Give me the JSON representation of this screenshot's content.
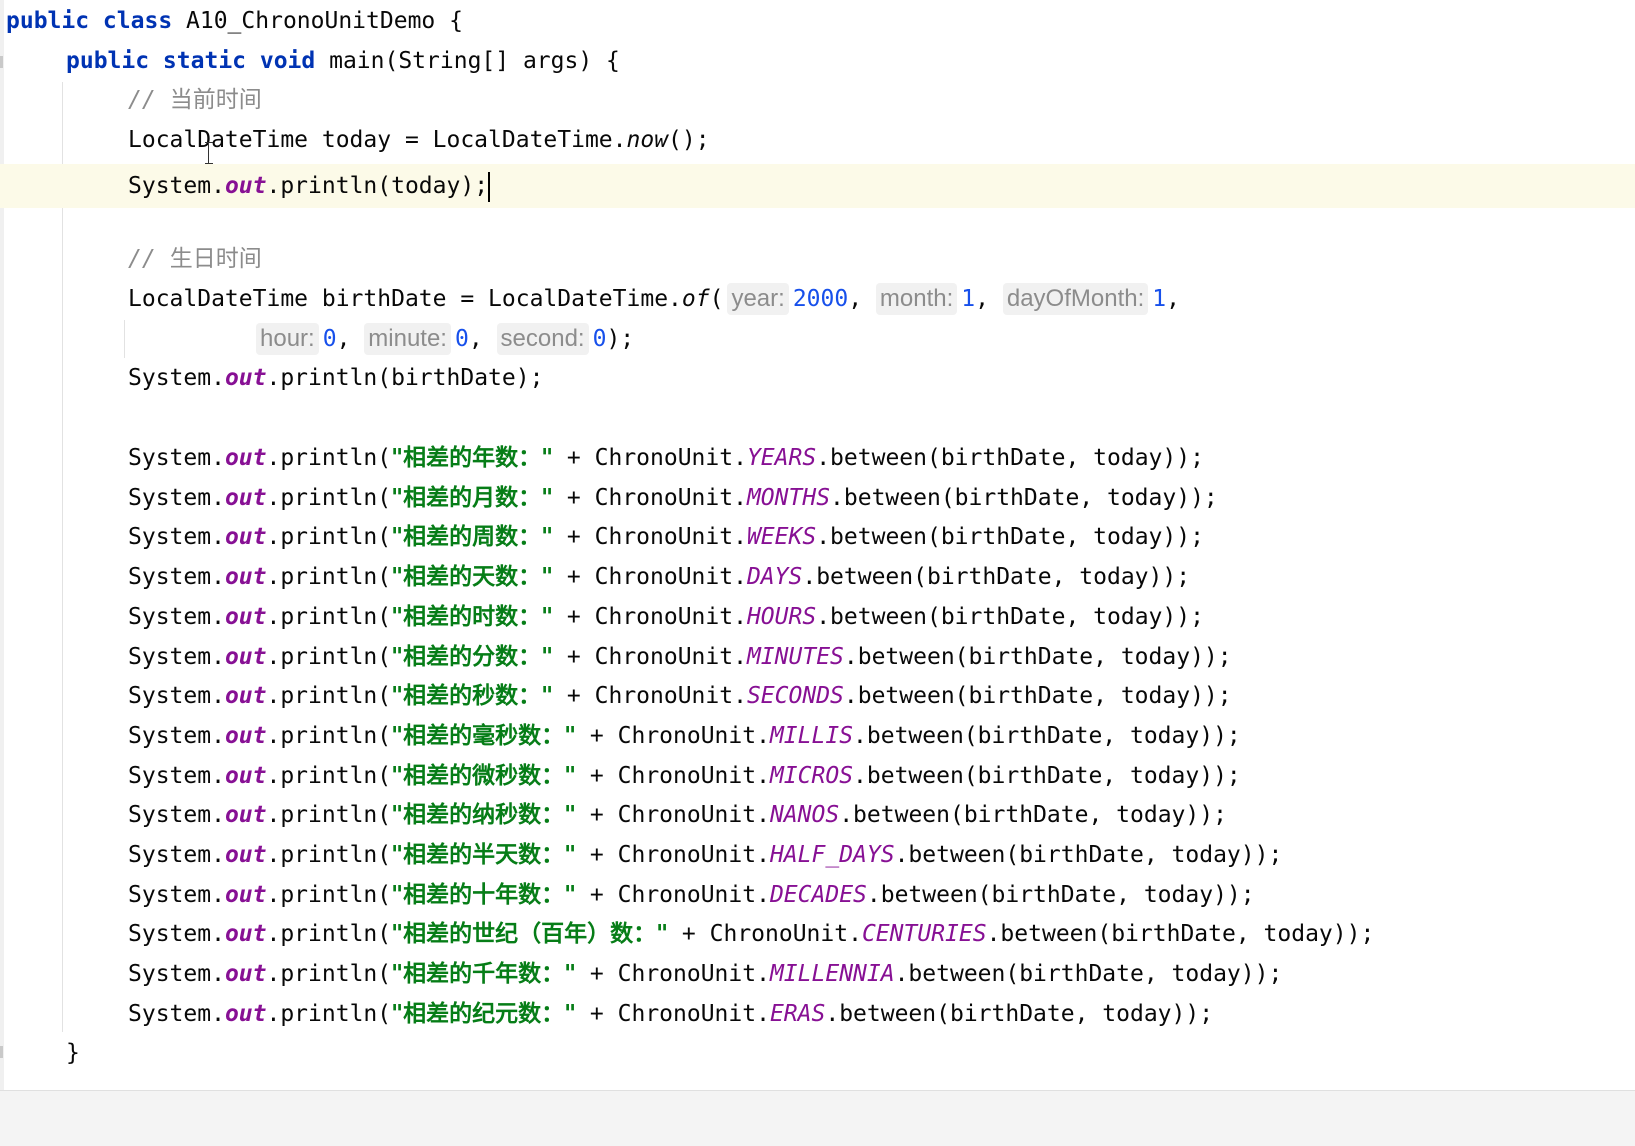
{
  "editor": {
    "class_decl": {
      "kw": "public class",
      "name": " A10_ChronoUnitDemo {"
    },
    "main_decl": {
      "kw": "public static void",
      "sig": " main(String[] args) {"
    },
    "comment_now": {
      "slashes": "//",
      "text": "当前时间"
    },
    "today_line": {
      "prefix": "LocalDateTime today = LocalDateTime.",
      "method": "now",
      "suffix": "();"
    },
    "println_today": {
      "sys": "System.",
      "out": "out",
      "rest": ".println(today);"
    },
    "comment_birth": {
      "slashes": "//",
      "text": "生日时间"
    },
    "birth_line": {
      "prefix": "LocalDateTime birthDate = LocalDateTime.",
      "method": "of",
      "open": "(",
      "year_hint": "year:",
      "year_val": "2000",
      "month_hint": "month:",
      "month_val": "1",
      "day_hint": "dayOfMonth:",
      "day_val": "1",
      "sep": ", ",
      "trail": ","
    },
    "birth_line2": {
      "hour_hint": "hour:",
      "hour_val": "0",
      "minute_hint": "minute:",
      "minute_val": "0",
      "second_hint": "second:",
      "second_val": "0",
      "close": ");"
    },
    "println_birth": {
      "sys": "System.",
      "out": "out",
      "rest": ".println(birthDate);"
    },
    "diff_lines": [
      {
        "str": "\"相差的年数：\"",
        "unit": "YEARS"
      },
      {
        "str": "\"相差的月数：\"",
        "unit": "MONTHS"
      },
      {
        "str": "\"相差的周数：\"",
        "unit": "WEEKS"
      },
      {
        "str": "\"相差的天数：\"",
        "unit": "DAYS"
      },
      {
        "str": "\"相差的时数：\"",
        "unit": "HOURS"
      },
      {
        "str": "\"相差的分数：\"",
        "unit": "MINUTES"
      },
      {
        "str": "\"相差的秒数：\"",
        "unit": "SECONDS"
      },
      {
        "str": "\"相差的毫秒数：\"",
        "unit": "MILLIS"
      },
      {
        "str": "\"相差的微秒数：\"",
        "unit": "MICROS"
      },
      {
        "str": "\"相差的纳秒数：\"",
        "unit": "NANOS"
      },
      {
        "str": "\"相差的半天数：\"",
        "unit": "HALF_DAYS"
      },
      {
        "str": "\"相差的十年数：\"",
        "unit": "DECADES"
      },
      {
        "str": "\"相差的世纪（百年）数：\"",
        "unit": "CENTURIES"
      },
      {
        "str": "\"相差的千年数：\"",
        "unit": "MILLENNIA"
      },
      {
        "str": "\"相差的纪元数：\"",
        "unit": "ERAS"
      }
    ],
    "diff_parts": {
      "sys": "System.",
      "out": "out",
      "println_open": ".println(",
      "plus": " + ChronoUnit.",
      "between": ".between(birthDate, today));"
    },
    "close_main": "}",
    "colors": {
      "keyword": "#0033b3",
      "field": "#871094",
      "string": "#067d17",
      "number": "#1750eb",
      "comment": "#8c8c8c",
      "current_line": "#fcfae8"
    }
  }
}
